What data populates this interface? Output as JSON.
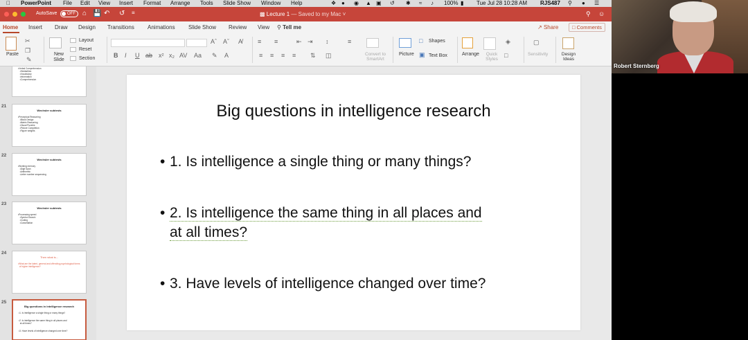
{
  "menubar": {
    "app_name": "PowerPoint",
    "menus": [
      "File",
      "Edit",
      "View",
      "Insert",
      "Format",
      "Arrange",
      "Tools",
      "Slide Show",
      "Window",
      "Help"
    ],
    "battery": "100%",
    "clock": "Tue Jul 28  10:28 AM",
    "user": "RJS487"
  },
  "titlebar": {
    "autosave_label": "AutoSave",
    "autosave_state": "OFF",
    "doc_name": "Lecture 1",
    "doc_status": "— Saved to my Mac ˅"
  },
  "tabs": {
    "items": [
      "Home",
      "Insert",
      "Draw",
      "Design",
      "Transitions",
      "Animations",
      "Slide Show",
      "Review",
      "View"
    ],
    "tell_me": "Tell me",
    "share": "Share",
    "comments": "Comments"
  },
  "ribbon": {
    "paste": "Paste",
    "new_slide": "New Slide",
    "layout": "Layout",
    "reset": "Reset",
    "section": "Section",
    "convert_smartart": "Convert to SmartArt",
    "picture": "Picture",
    "shapes": "Shapes",
    "text_box": "Text Box",
    "arrange": "Arrange",
    "quick_styles": "Quick Styles",
    "sensitivity": "Sensitivity",
    "design_ideas": "Design Ideas"
  },
  "thumbnails": [
    {
      "num": "",
      "title": "",
      "lines": [
        "•Verbal Comprehension",
        "   •Similarities",
        "   •Vocabulary",
        "   •Information",
        "   •Comprehension"
      ]
    },
    {
      "num": "21",
      "title": "Wechsler subtests",
      "lines": [
        "•Perceptual Reasoning",
        "   •Block Design",
        "   •Matrix Reasoning",
        "   •Visual Puzzles",
        "   •Picture Completion",
        "   •Figure weights"
      ]
    },
    {
      "num": "22",
      "title": "Wechsler subtests",
      "lines": [
        "•Working memory",
        "   •Digit Span",
        "   •Arithmetic",
        "   •Letter number sequencing"
      ]
    },
    {
      "num": "23",
      "title": "Wechsler subtests",
      "lines": [
        "•Processing speed",
        "   •Symbol Search",
        "   •Coding",
        "   •Cancellation"
      ]
    },
    {
      "num": "24",
      "title": "Then what is...",
      "lines": [
        "•What are the latent, general and offending psychological forms",
        "  of higher intelligence?"
      ]
    },
    {
      "num": "25",
      "title": "Big questions in intelligence research",
      "lines": [
        "•1. Is intelligence a single thing or many things?",
        "",
        "•2. Is intelligence the same thing in all places and",
        "  at all times?",
        "",
        "•3. Have levels of intelligence changed over time?"
      ]
    }
  ],
  "slide": {
    "title": "Big questions in intelligence research",
    "bullets": [
      {
        "line1": "1. Is intelligence a single thing or many things?",
        "line2": ""
      },
      {
        "line1": "2. Is intelligence the same thing in all places and",
        "line2": "at all times?"
      },
      {
        "line1": "3. Have levels of intelligence changed over time?",
        "line2": ""
      }
    ]
  },
  "webcam": {
    "participant_name": "Robert Sternberg"
  },
  "colors": {
    "title_bar": "#c6453a",
    "accent": "#b7472a",
    "selected_thumb": "#c75b3f"
  }
}
